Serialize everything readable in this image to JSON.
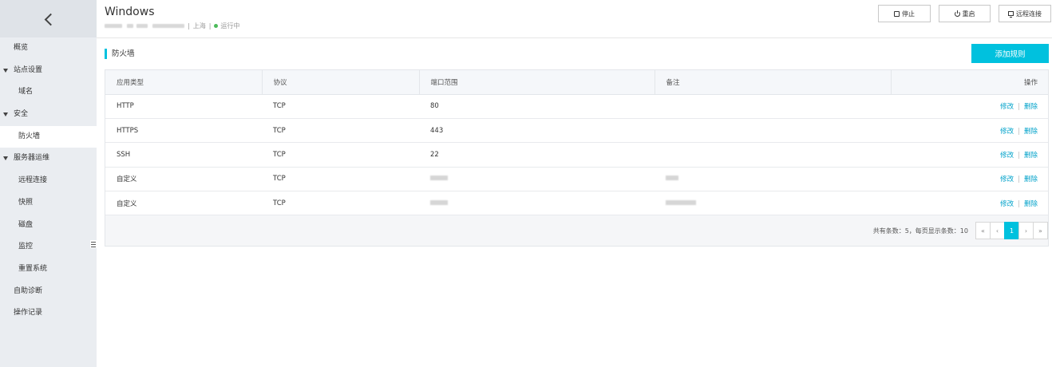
{
  "sidebar": {
    "items": [
      {
        "label": "概览",
        "level": 0,
        "caret": false,
        "active": false
      },
      {
        "label": "站点设置",
        "level": 0,
        "caret": true,
        "active": false
      },
      {
        "label": "域名",
        "level": 1,
        "caret": false,
        "active": false
      },
      {
        "label": "安全",
        "level": 0,
        "caret": true,
        "active": false
      },
      {
        "label": "防火墙",
        "level": 1,
        "caret": false,
        "active": true
      },
      {
        "label": "服务器运维",
        "level": 0,
        "caret": true,
        "active": false
      },
      {
        "label": "远程连接",
        "level": 1,
        "caret": false,
        "active": false
      },
      {
        "label": "快照",
        "level": 1,
        "caret": false,
        "active": false
      },
      {
        "label": "磁盘",
        "level": 1,
        "caret": false,
        "active": false
      },
      {
        "label": "监控",
        "level": 1,
        "caret": false,
        "active": false
      },
      {
        "label": "重置系统",
        "level": 1,
        "caret": false,
        "active": false
      },
      {
        "label": "自助诊断",
        "level": 0,
        "caret": false,
        "active": false
      },
      {
        "label": "操作记录",
        "level": 0,
        "caret": false,
        "active": false
      }
    ]
  },
  "header": {
    "title": "Windows",
    "region": "上海",
    "status": "运行中",
    "status_color": "#4cbb5a",
    "buttons": {
      "stop": "停止",
      "restart": "重启",
      "remote": "远程连接"
    }
  },
  "section": {
    "title": "防火墙",
    "add_button": "添加规则"
  },
  "table": {
    "columns": [
      "应用类型",
      "协议",
      "端口范围",
      "备注",
      "操作"
    ],
    "rows": [
      {
        "app": "HTTP",
        "protocol": "TCP",
        "port": "80",
        "note": ""
      },
      {
        "app": "HTTPS",
        "protocol": "TCP",
        "port": "443",
        "note": ""
      },
      {
        "app": "SSH",
        "protocol": "TCP",
        "port": "22",
        "note": ""
      },
      {
        "app": "自定义",
        "protocol": "TCP",
        "port": "",
        "note": ""
      },
      {
        "app": "自定义",
        "protocol": "TCP",
        "port": "",
        "note": ""
      }
    ],
    "edit_label": "修改",
    "delete_label": "删除"
  },
  "pagination": {
    "summary": "共有条数：5，每页显示条数：10",
    "first": "«",
    "prev": "‹",
    "current": "1",
    "next": "›",
    "last": "»"
  },
  "colors": {
    "accent": "#00c1de",
    "link": "#00a2ca"
  }
}
